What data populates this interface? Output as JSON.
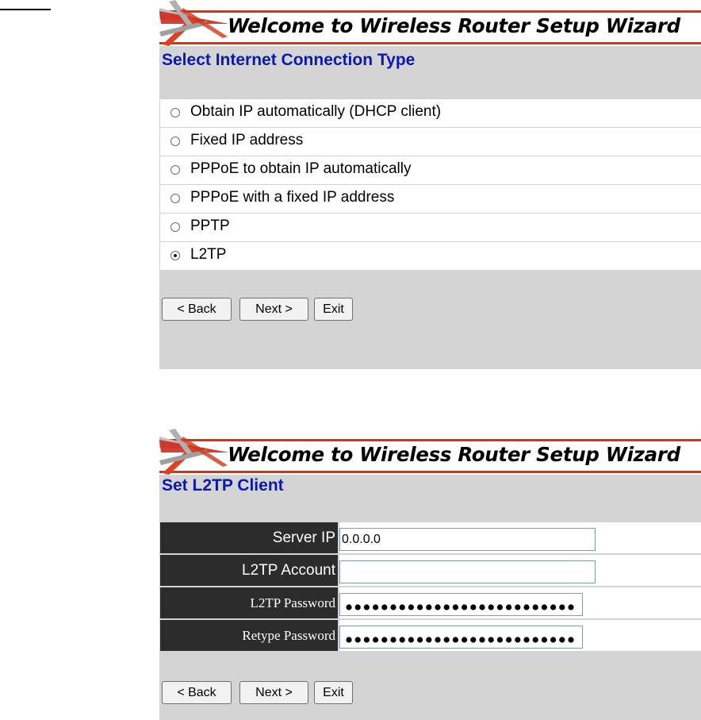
{
  "banner": {
    "title": "Welcome to Wireless Router Setup Wizard"
  },
  "connection_type": {
    "title": "Select Internet Connection Type",
    "options": [
      {
        "label": "Obtain IP automatically (DHCP client)",
        "selected": false
      },
      {
        "label": "Fixed IP address",
        "selected": false
      },
      {
        "label": "PPPoE to obtain IP automatically",
        "selected": false
      },
      {
        "label": "PPPoE with a fixed IP address",
        "selected": false
      },
      {
        "label": "PPTP",
        "selected": false
      },
      {
        "label": "L2TP",
        "selected": true
      }
    ]
  },
  "l2tp_client": {
    "title": "Set L2TP Client",
    "fields": {
      "server_ip": {
        "label": "Server IP",
        "value": "0.0.0.0"
      },
      "account": {
        "label": "L2TP Account",
        "value": ""
      },
      "password": {
        "label": "L2TP Password",
        "masked_length": 26
      },
      "retype_password": {
        "label": "Retype Password",
        "masked_length": 26
      }
    }
  },
  "buttons": {
    "back": "< Back",
    "next": "Next >",
    "exit": "Exit"
  },
  "colors": {
    "accent_title": "#0a1ab0",
    "banner_rule": "#e03010",
    "panel_bg": "#d4d4d4",
    "label_bg": "#2c2c2c"
  }
}
